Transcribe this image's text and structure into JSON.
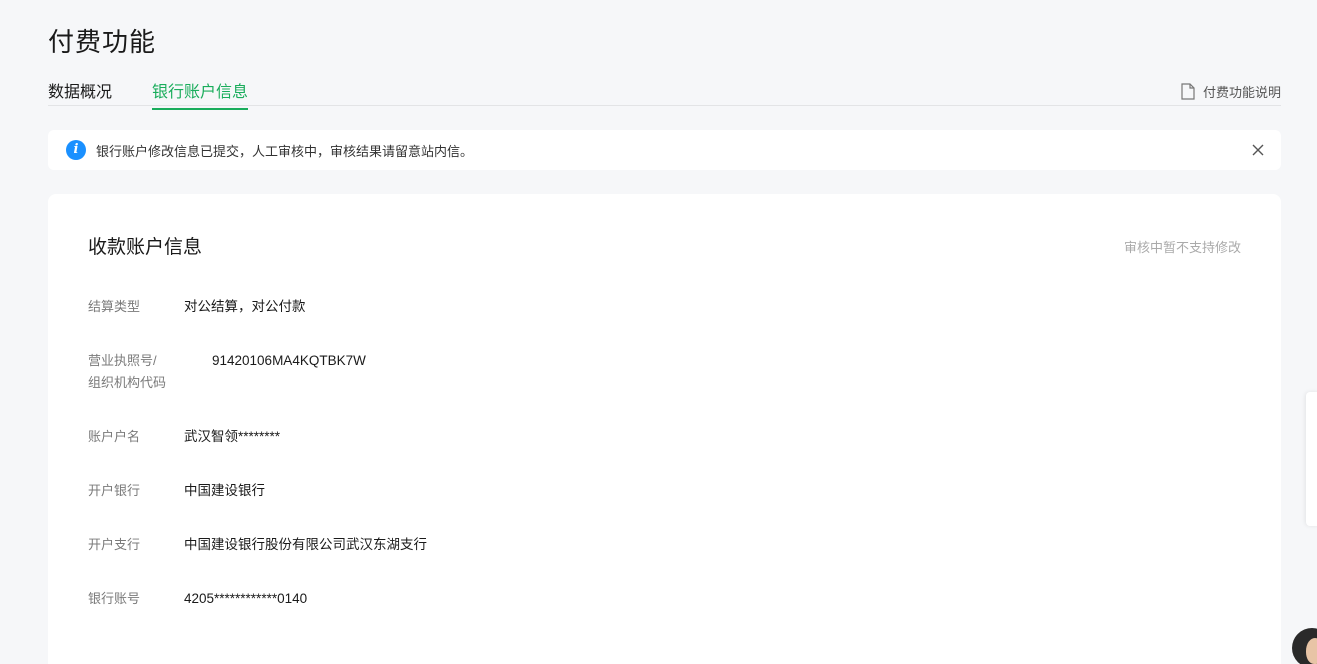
{
  "page": {
    "title": "付费功能"
  },
  "tabs": [
    {
      "label": "数据概况",
      "active": false
    },
    {
      "label": "银行账户信息",
      "active": true
    }
  ],
  "help_link": {
    "label": "付费功能说明"
  },
  "notice": {
    "text": "银行账户修改信息已提交，人工审核中，审核结果请留意站内信。"
  },
  "card": {
    "title": "收款账户信息",
    "aside": "审核中暂不支持修改",
    "fields": {
      "settlement_type": {
        "label": "结算类型",
        "value": "对公结算，对公付款"
      },
      "license": {
        "label_line1": "营业执照号/",
        "label_line2": "组织机构代码",
        "value": "91420106MA4KQTBK7W"
      },
      "account_name": {
        "label": "账户户名",
        "value": "武汉智领********"
      },
      "bank": {
        "label": "开户银行",
        "value": "中国建设银行"
      },
      "branch": {
        "label": "开户支行",
        "value": "中国建设银行股份有限公司武汉东湖支行"
      },
      "account_no": {
        "label": "银行账号",
        "value": "4205************0140"
      }
    }
  },
  "colors": {
    "accent": "#1aad5c",
    "info": "#1a90ff",
    "background": "#f6f7f9"
  },
  "icons": {
    "help": "document-icon",
    "notice": "info-icon",
    "close": "close-icon"
  }
}
